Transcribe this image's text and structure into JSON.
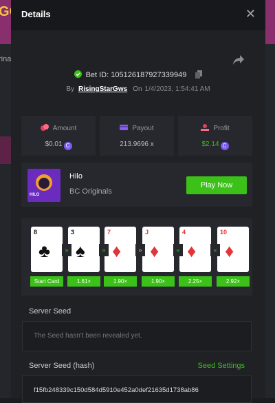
{
  "background": {
    "logo_text": "GO",
    "side_text": "rina"
  },
  "modal": {
    "title": "Details",
    "close_glyph": "✕"
  },
  "bet": {
    "id_label": "Bet ID:",
    "id_value": "105126187927339949",
    "by_label": "By",
    "user": "RisingStarGws",
    "on_label": "On",
    "date": "1/4/2023, 1:54:41 AM"
  },
  "stats": {
    "amount": {
      "label": "Amount",
      "value": "$0.01"
    },
    "payout": {
      "label": "Payout",
      "value": "213.9696 x"
    },
    "profit": {
      "label": "Profit",
      "value": "$2.14"
    }
  },
  "game": {
    "name": "Hilo",
    "provider": "BC Originals",
    "thumb_text": "HILO",
    "play_label": "Play Now"
  },
  "cards": [
    {
      "rank": "8",
      "suit": "♣",
      "color": "blk",
      "mult": "Start Card"
    },
    {
      "rank": "3",
      "suit": "♠",
      "color": "blk",
      "mult": "1.61×"
    },
    {
      "rank": "7",
      "suit": "♦",
      "color": "red",
      "mult": "1.90×"
    },
    {
      "rank": "J",
      "suit": "♦",
      "color": "red",
      "mult": "1.90×"
    },
    {
      "rank": "4",
      "suit": "♦",
      "color": "red",
      "mult": "2.25×"
    },
    {
      "rank": "10",
      "suit": "♦",
      "color": "red",
      "mult": "2.92×"
    }
  ],
  "badges": [
    "»",
    "«",
    "»",
    "«",
    "«"
  ],
  "server_seed": {
    "label": "Server Seed",
    "placeholder": "The Seed hasn't been revealed yet."
  },
  "server_seed_hash": {
    "label": "Server Seed (hash)",
    "settings_label": "Seed Settings",
    "value": "f15fb248339c150d584d5910e452a0def21635d1738ab86"
  },
  "colors": {
    "accent": "#3bc117",
    "coin": "#7a5cf0",
    "bg": "#1f2125"
  }
}
